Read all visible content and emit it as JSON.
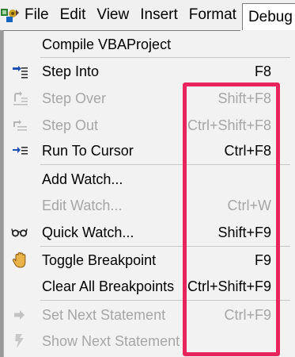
{
  "menubar": {
    "items": [
      {
        "label": "File",
        "open": false
      },
      {
        "label": "Edit",
        "open": false
      },
      {
        "label": "View",
        "open": false
      },
      {
        "label": "Insert",
        "open": false
      },
      {
        "label": "Format",
        "open": false
      },
      {
        "label": "Debug",
        "open": true
      }
    ]
  },
  "debug_menu": {
    "items": [
      {
        "label": "Compile VBAProject",
        "shortcut": "",
        "enabled": true,
        "icon": "none"
      },
      {
        "label": "Step Into",
        "shortcut": "F8",
        "enabled": true,
        "icon": "step-into-icon"
      },
      {
        "label": "Step Over",
        "shortcut": "Shift+F8",
        "enabled": false,
        "icon": "step-over-icon"
      },
      {
        "label": "Step Out",
        "shortcut": "Ctrl+Shift+F8",
        "enabled": false,
        "icon": "step-out-icon"
      },
      {
        "label": "Run To Cursor",
        "shortcut": "Ctrl+F8",
        "enabled": true,
        "icon": "run-to-cursor-icon"
      },
      {
        "label": "Add Watch...",
        "shortcut": "",
        "enabled": true,
        "icon": "none"
      },
      {
        "label": "Edit Watch...",
        "shortcut": "Ctrl+W",
        "enabled": false,
        "icon": "none"
      },
      {
        "label": "Quick Watch...",
        "shortcut": "Shift+F9",
        "enabled": true,
        "icon": "glasses-icon"
      },
      {
        "label": "Toggle Breakpoint",
        "shortcut": "F9",
        "enabled": true,
        "icon": "hand-icon"
      },
      {
        "label": "Clear All Breakpoints",
        "shortcut": "Ctrl+Shift+F9",
        "enabled": true,
        "icon": "none"
      },
      {
        "label": "Set Next Statement",
        "shortcut": "Ctrl+F9",
        "enabled": false,
        "icon": "arrow-right-icon"
      },
      {
        "label": "Show Next Statement",
        "shortcut": "",
        "enabled": false,
        "icon": "show-next-icon"
      }
    ]
  },
  "annotation": {
    "highlight_color": "#e8245d",
    "target": "shortcut column"
  },
  "colors": {
    "menu_background": "#f2f2f2",
    "disabled_text": "#a6a6a6",
    "enabled_text": "#000000"
  }
}
